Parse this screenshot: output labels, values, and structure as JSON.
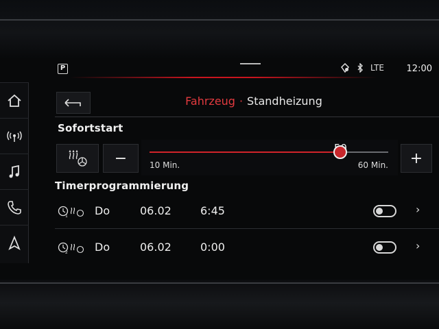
{
  "statusbar": {
    "parking_label": "P",
    "lte_label": "LTE",
    "clock": "12:00"
  },
  "header": {
    "breadcrumb_parent": "Fahrzeug",
    "breadcrumb_sep": "·",
    "breadcrumb_current": "Standheizung"
  },
  "sofortstart": {
    "label": "Sofortstart",
    "minus_label": "−",
    "plus_label": "+",
    "slider": {
      "value": 50,
      "min": 10,
      "max": 60,
      "min_label": "10 Min.",
      "max_label": "60 Min."
    }
  },
  "timer": {
    "label": "Timerprogrammierung",
    "rows": [
      {
        "day": "Do",
        "date": "06.02",
        "time": "6:45",
        "enabled": false,
        "chevron": "›"
      },
      {
        "day": "Do",
        "date": "06.02",
        "time": "0:00",
        "enabled": false,
        "chevron": "›"
      }
    ]
  },
  "sidebar": {
    "items": [
      "home-icon",
      "radio-icon",
      "music-icon",
      "phone-icon",
      "navigation-icon"
    ]
  },
  "colors": {
    "accent": "#d2232a",
    "background": "#08090a",
    "text": "#e8e8e8"
  }
}
